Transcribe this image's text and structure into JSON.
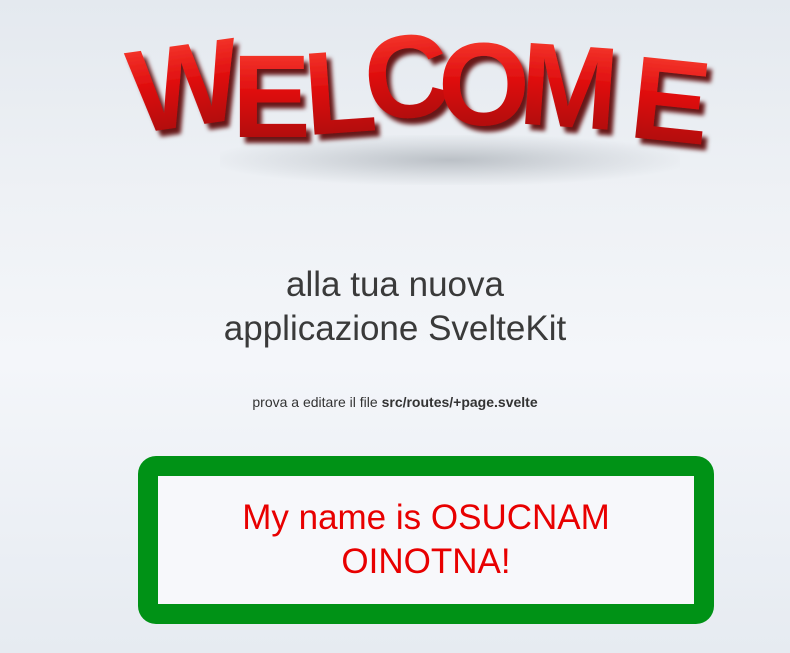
{
  "header": {
    "welcome_text": "WELCOME",
    "welcome_color": "#d91414"
  },
  "main": {
    "tagline_line1": "alla tua nuova",
    "tagline_line2": "applicazione SvelteKit",
    "hint_prefix": "prova a editare il file ",
    "hint_file": "src/routes/+page.svelte"
  },
  "name_box": {
    "text": "My name is OSUCNAM OINOTNA!",
    "border_color": "#009216",
    "text_color": "#e80000"
  }
}
